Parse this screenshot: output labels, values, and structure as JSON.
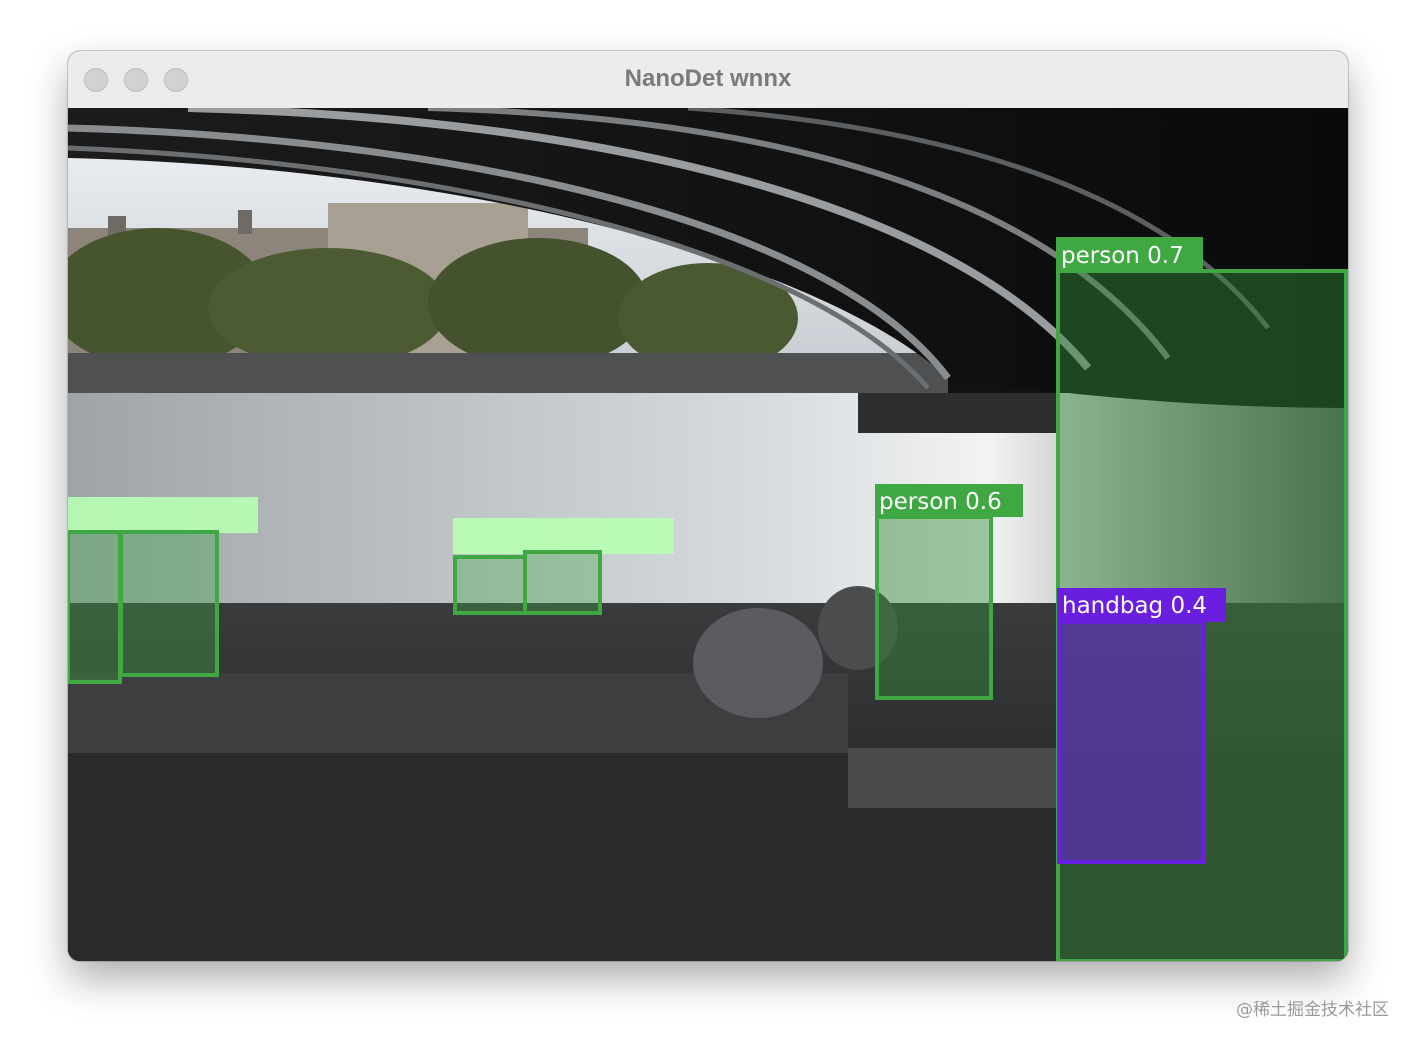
{
  "window": {
    "title": "NanoDet wnnx"
  },
  "titlebar": {
    "buttons": [
      "close",
      "minimize",
      "zoom"
    ]
  },
  "colors": {
    "person": "#3fa843",
    "handbag": "#6a1fe0",
    "unlabeled": "#b6ffb2"
  },
  "detections": [
    {
      "label": "person 0.7"
    },
    {
      "label": "person 0.6"
    },
    {
      "label": "handbag 0.4"
    }
  ],
  "watermark": "@稀土掘金技术社区"
}
